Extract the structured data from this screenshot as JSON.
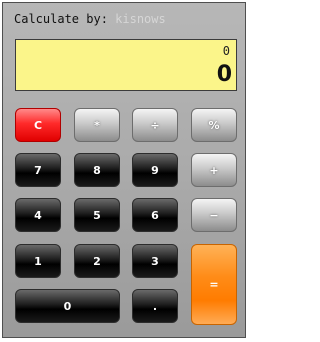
{
  "header": {
    "label": "Calculate by:",
    "author": "kisnows"
  },
  "display": {
    "previous": "0",
    "current": "0"
  },
  "buttons": {
    "clear": "C",
    "multiply": "*",
    "divide": "÷",
    "percent": "%",
    "seven": "7",
    "eight": "8",
    "nine": "9",
    "add": "+",
    "four": "4",
    "five": "5",
    "six": "6",
    "subtract": "−",
    "one": "1",
    "two": "2",
    "three": "3",
    "equals": "=",
    "zero": "0",
    "decimal": "."
  },
  "colors": {
    "display_background": "#fbf58a",
    "clear_button": "#ff2a2a",
    "equals_button": "#ff8c18",
    "number_button": "#000000",
    "operator_button": "#c9c9c9"
  }
}
